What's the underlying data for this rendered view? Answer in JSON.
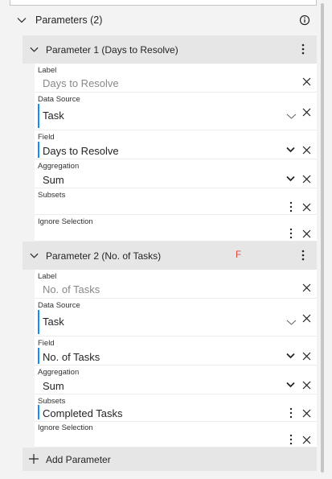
{
  "section": {
    "title": "Parameters (2)",
    "info_icon": "info-icon"
  },
  "parameters": [
    {
      "title": "Parameter 1 (Days to Resolve)",
      "flag": "",
      "label_caption": "Label",
      "label_placeholder": "Days to Resolve",
      "datasource_caption": "Data Source",
      "datasource_value": "Task",
      "field_caption": "Field",
      "field_value": "Days to Resolve",
      "aggregation_caption": "Aggregation",
      "aggregation_value": "Sum",
      "subsets_caption": "Subsets",
      "subsets_value": "",
      "ignore_caption": "Ignore Selection"
    },
    {
      "title": "Parameter 2 (No. of Tasks)",
      "flag": "F",
      "label_caption": "Label",
      "label_placeholder": "No. of Tasks",
      "datasource_caption": "Data Source",
      "datasource_value": "Task",
      "field_caption": "Field",
      "field_value": "No. of Tasks",
      "aggregation_caption": "Aggregation",
      "aggregation_value": "Sum",
      "subsets_caption": "Subsets",
      "subsets_value": "Completed Tasks",
      "ignore_caption": "Ignore Selection"
    }
  ],
  "add_parameter_label": "Add Parameter",
  "colors": {
    "accent": "#118dff",
    "flag": "#e0443e",
    "header_bg": "#e6e6e6",
    "panel_bg": "#f3f3f3"
  }
}
